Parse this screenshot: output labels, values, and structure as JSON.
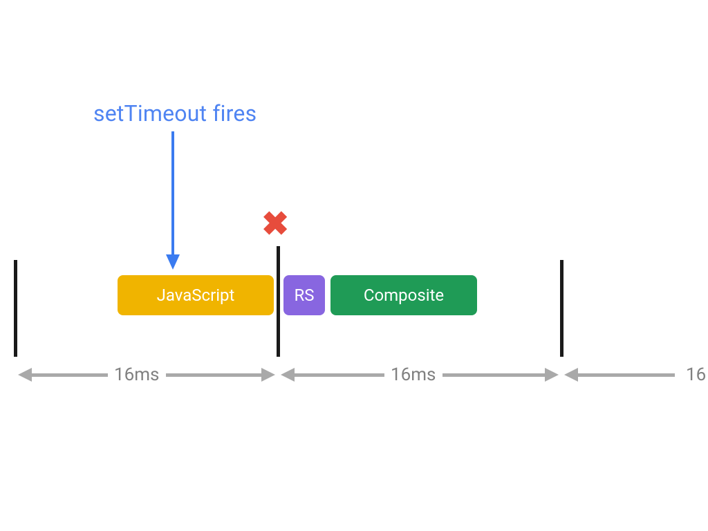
{
  "colors": {
    "accent_blue": "#3a7bf0",
    "annot_blue": "#4f84f2",
    "arrow_gray": "#a9a9a9",
    "tick_black": "#1a1a1a",
    "cross_red": "#e74c3c",
    "js_yellow": "#f0b400",
    "rs_purple": "#8866e0",
    "composite_green": "#1f9b56"
  },
  "annotation": {
    "label": "setTimeout fires"
  },
  "cross": {
    "glyph": "✖"
  },
  "blocks": {
    "js": "JavaScript",
    "rs": "RS",
    "composite": "Composite"
  },
  "spans": {
    "first": "16ms",
    "second": "16ms",
    "third_partial": "16"
  },
  "chart_data": {
    "type": "timeline",
    "title": "setTimeout fires mid-frame causing missed frame",
    "frame_duration_ms": 16,
    "frames_shown": 3,
    "event": {
      "name": "setTimeout fires",
      "frame_index": 0,
      "approx_offset_in_frame_ms": 8.5
    },
    "missed_frame_boundary_index": 1,
    "pipeline_stages": [
      {
        "name": "JavaScript",
        "color": "#f0b400",
        "start_frame": 0,
        "start_offset_ms": 6.5,
        "duration_ms": 9.5
      },
      {
        "name": "RS",
        "color": "#8866e0",
        "start_frame": 1,
        "start_offset_ms": 0.5,
        "duration_ms": 2.5
      },
      {
        "name": "Composite",
        "color": "#1f9b56",
        "start_frame": 1,
        "start_offset_ms": 3.5,
        "duration_ms": 9.0
      }
    ]
  }
}
